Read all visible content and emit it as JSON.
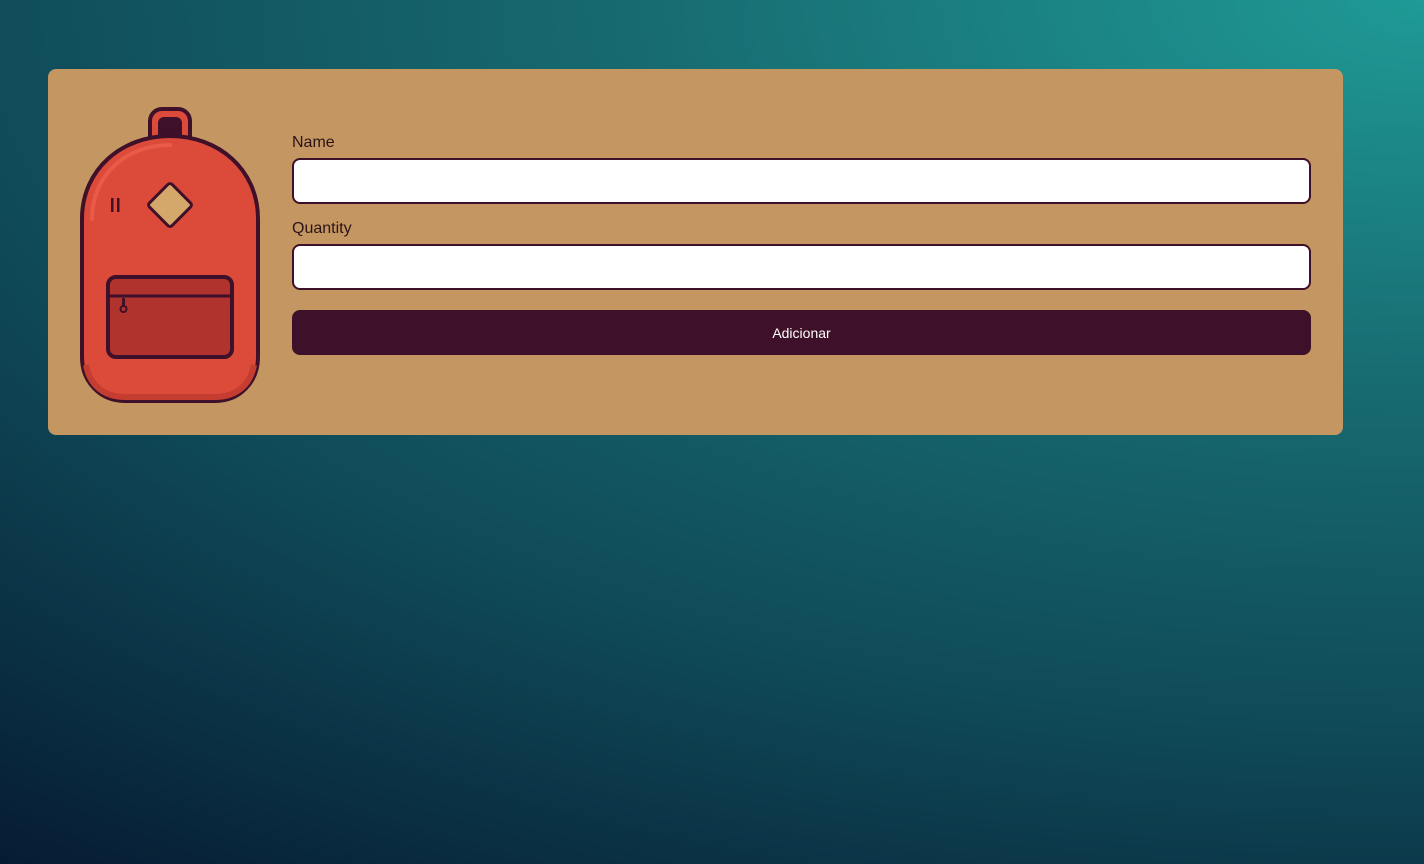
{
  "form": {
    "name_label": "Name",
    "name_value": "",
    "quantity_label": "Quantity",
    "quantity_value": "",
    "submit_label": "Adicionar"
  },
  "colors": {
    "background_start": "#1f9a96",
    "background_end": "#061a32",
    "card": "#c49661",
    "accent": "#3e1029",
    "backpack_body": "#dc4a3a",
    "backpack_pocket": "#b0332e",
    "input_background": "#ffffff"
  },
  "icons": {
    "logo": "backpack-icon"
  }
}
